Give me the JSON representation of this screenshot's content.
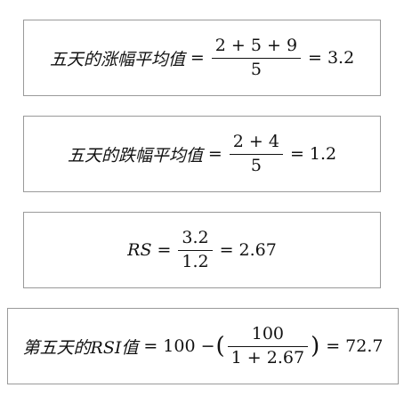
{
  "formulas": {
    "f1": {
      "lhs": "五天的涨幅平均值",
      "eq": "=",
      "numerator": "2 + 5 + 9",
      "denominator": "5",
      "eq2": "=",
      "result": "3.2"
    },
    "f2": {
      "lhs": "五天的跌幅平均值",
      "eq": "=",
      "numerator": "2 + 4",
      "denominator": "5",
      "eq2": "=",
      "result": "1.2"
    },
    "f3": {
      "lhs": "RS",
      "eq": "=",
      "numerator": "3.2",
      "denominator": "1.2",
      "eq2": "=",
      "result": "2.67"
    },
    "f4": {
      "lhs": "第五天的RSI值",
      "eq": "=",
      "prefix": "100 −",
      "open_paren": "(",
      "numerator": "100",
      "denominator": "1 + 2.67",
      "close_paren": ")",
      "eq2": "=",
      "result": "72.7"
    }
  }
}
